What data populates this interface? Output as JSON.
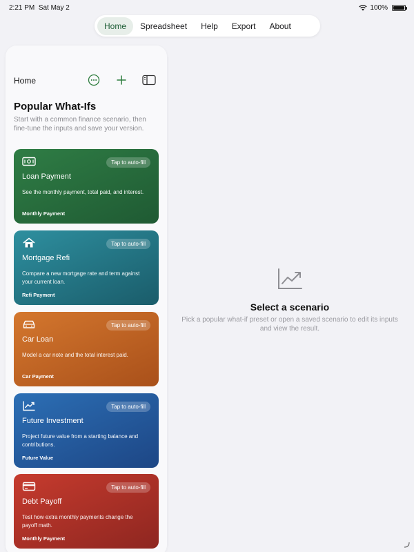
{
  "status": {
    "time": "2:21 PM",
    "date": "Sat May 2",
    "battery": "100%",
    "battery_level": 1.0
  },
  "nav": {
    "tabs": [
      {
        "label": "Home",
        "active": true
      },
      {
        "label": "Spreadsheet",
        "active": false
      },
      {
        "label": "Help",
        "active": false
      },
      {
        "label": "Export",
        "active": false
      },
      {
        "label": "About",
        "active": false
      }
    ]
  },
  "sidebar": {
    "title": "Home",
    "icons": [
      "more-icon",
      "add-icon",
      "sidebar-toggle-icon"
    ],
    "section_title": "Popular What-Ifs",
    "section_subtitle": "Start with a common finance scenario, then fine-tune the inputs and save your version.",
    "cards": [
      {
        "icon": "money-icon",
        "badge": "Tap to auto-fill",
        "title": "Loan Payment",
        "description": "See the monthly payment, total paid, and interest.",
        "footer": "Monthly Payment",
        "color_start": "#2f7d45",
        "color_end": "#1f5a33"
      },
      {
        "icon": "house-icon",
        "badge": "Tap to auto-fill",
        "title": "Mortgage Refi",
        "description": "Compare a new mortgage rate and term against your current loan.",
        "footer": "Refi Payment",
        "color_start": "#2e8f9f",
        "color_end": "#1a5c6a"
      },
      {
        "icon": "car-icon",
        "badge": "Tap to auto-fill",
        "title": "Car Loan",
        "description": "Model a car note and the total interest paid.",
        "footer": "Car Payment",
        "color_start": "#d4772e",
        "color_end": "#a9501a"
      },
      {
        "icon": "chart-icon",
        "badge": "Tap to auto-fill",
        "title": "Future Investment",
        "description": "Project future value from a starting balance and contributions.",
        "footer": "Future Value",
        "color_start": "#2c6fb5",
        "color_end": "#1d4685"
      },
      {
        "icon": "credit-card-icon",
        "badge": "Tap to auto-fill",
        "title": "Debt Payoff",
        "description": "Test how extra monthly payments change the payoff math.",
        "footer": "Monthly Payment",
        "color_start": "#c63b2e",
        "color_end": "#8e2620"
      }
    ]
  },
  "main": {
    "empty_icon": "chart-line-icon",
    "empty_title": "Select a scenario",
    "empty_subtitle": "Pick a popular what-if preset or open a saved scenario to edit its inputs and view the result."
  }
}
